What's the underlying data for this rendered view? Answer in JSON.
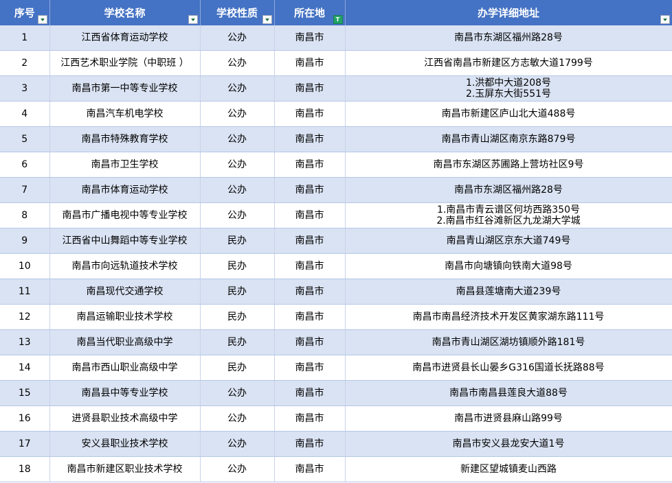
{
  "headers": [
    "序号",
    "学校名称",
    "学校性质",
    "所在地",
    "办学详细地址"
  ],
  "rows": [
    {
      "no": "1",
      "name": "江西省体育运动学校",
      "type": "公办",
      "city": "南昌市",
      "address": [
        "南昌市东湖区福州路28号"
      ]
    },
    {
      "no": "2",
      "name": "江西艺术职业学院（中职班 ）",
      "type": "公办",
      "city": "南昌市",
      "address": [
        "江西省南昌市新建区方志敏大道1799号"
      ]
    },
    {
      "no": "3",
      "name": "南昌市第一中等专业学校",
      "type": "公办",
      "city": "南昌市",
      "address": [
        "1.洪都中大道208号",
        "2.玉屏东大街551号"
      ]
    },
    {
      "no": "4",
      "name": "南昌汽车机电学校",
      "type": "公办",
      "city": "南昌市",
      "address": [
        "南昌市新建区庐山北大道488号"
      ]
    },
    {
      "no": "5",
      "name": "南昌市特殊教育学校",
      "type": "公办",
      "city": "南昌市",
      "address": [
        "南昌市青山湖区南京东路879号"
      ]
    },
    {
      "no": "6",
      "name": "南昌市卫生学校",
      "type": "公办",
      "city": "南昌市",
      "address": [
        "南昌市东湖区苏圃路上营坊社区9号"
      ]
    },
    {
      "no": "7",
      "name": "南昌市体育运动学校",
      "type": "公办",
      "city": "南昌市",
      "address": [
        "南昌市东湖区福州路28号"
      ]
    },
    {
      "no": "8",
      "name": "南昌市广播电视中等专业学校",
      "type": "公办",
      "city": "南昌市",
      "address": [
        "1.南昌市青云谱区何坊西路350号",
        "2.南昌市红谷滩新区九龙湖大学城"
      ]
    },
    {
      "no": "9",
      "name": "江西省中山舞蹈中等专业学校",
      "type": "民办",
      "city": "南昌市",
      "address": [
        "南昌青山湖区京东大道749号"
      ]
    },
    {
      "no": "10",
      "name": "南昌市向远轨道技术学校",
      "type": "民办",
      "city": "南昌市",
      "address": [
        "南昌市向塘镇向铁南大道98号"
      ]
    },
    {
      "no": "11",
      "name": "南昌现代交通学校",
      "type": "民办",
      "city": "南昌市",
      "address": [
        "南昌县莲塘南大道239号"
      ]
    },
    {
      "no": "12",
      "name": "南昌运输职业技术学校",
      "type": "民办",
      "city": "南昌市",
      "address": [
        "南昌市南昌经济技术开发区黄家湖东路111号"
      ]
    },
    {
      "no": "13",
      "name": "南昌当代职业高级中学",
      "type": "民办",
      "city": "南昌市",
      "address": [
        "南昌市青山湖区湖坊镇顺外路181号"
      ]
    },
    {
      "no": "14",
      "name": "南昌市西山职业高级中学",
      "type": "民办",
      "city": "南昌市",
      "address": [
        "南昌市进贤县长山晏乡G316国道长抚路88号"
      ]
    },
    {
      "no": "15",
      "name": "南昌县中等专业学校",
      "type": "公办",
      "city": "南昌市",
      "address": [
        "南昌市南昌县莲良大道88号"
      ]
    },
    {
      "no": "16",
      "name": "进贤县职业技术高级中学",
      "type": "公办",
      "city": "南昌市",
      "address": [
        "南昌市进贤县麻山路99号"
      ]
    },
    {
      "no": "17",
      "name": "安义县职业技术学校",
      "type": "公办",
      "city": "南昌市",
      "address": [
        "南昌市安义县龙安大道1号"
      ]
    },
    {
      "no": "18",
      "name": "南昌市新建区职业技术学校",
      "type": "公办",
      "city": "南昌市",
      "address": [
        "新建区望城镇麦山西路"
      ]
    }
  ]
}
